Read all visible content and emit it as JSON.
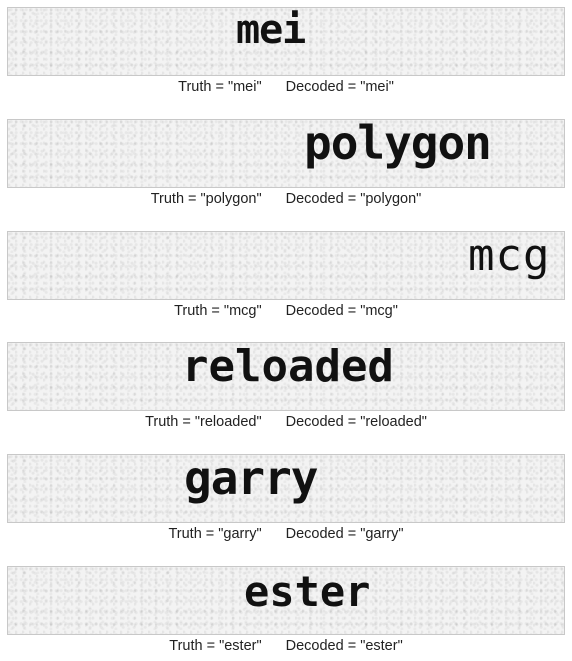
{
  "samples": [
    {
      "image_text": "mei",
      "truth_label": "Truth = \"mei\"",
      "decoded_label": "Decoded = \"mei\""
    },
    {
      "image_text": "polygon",
      "truth_label": "Truth = \"polygon\"",
      "decoded_label": "Decoded = \"polygon\""
    },
    {
      "image_text": "mcg",
      "truth_label": "Truth = \"mcg\"",
      "decoded_label": "Decoded = \"mcg\""
    },
    {
      "image_text": "reloaded",
      "truth_label": "Truth = \"reloaded\"",
      "decoded_label": "Decoded = \"reloaded\""
    },
    {
      "image_text": "garry",
      "truth_label": "Truth = \"garry\"",
      "decoded_label": "Decoded = \"garry\""
    },
    {
      "image_text": "ester",
      "truth_label": "Truth = \"ester\"",
      "decoded_label": "Decoded = \"ester\""
    }
  ]
}
